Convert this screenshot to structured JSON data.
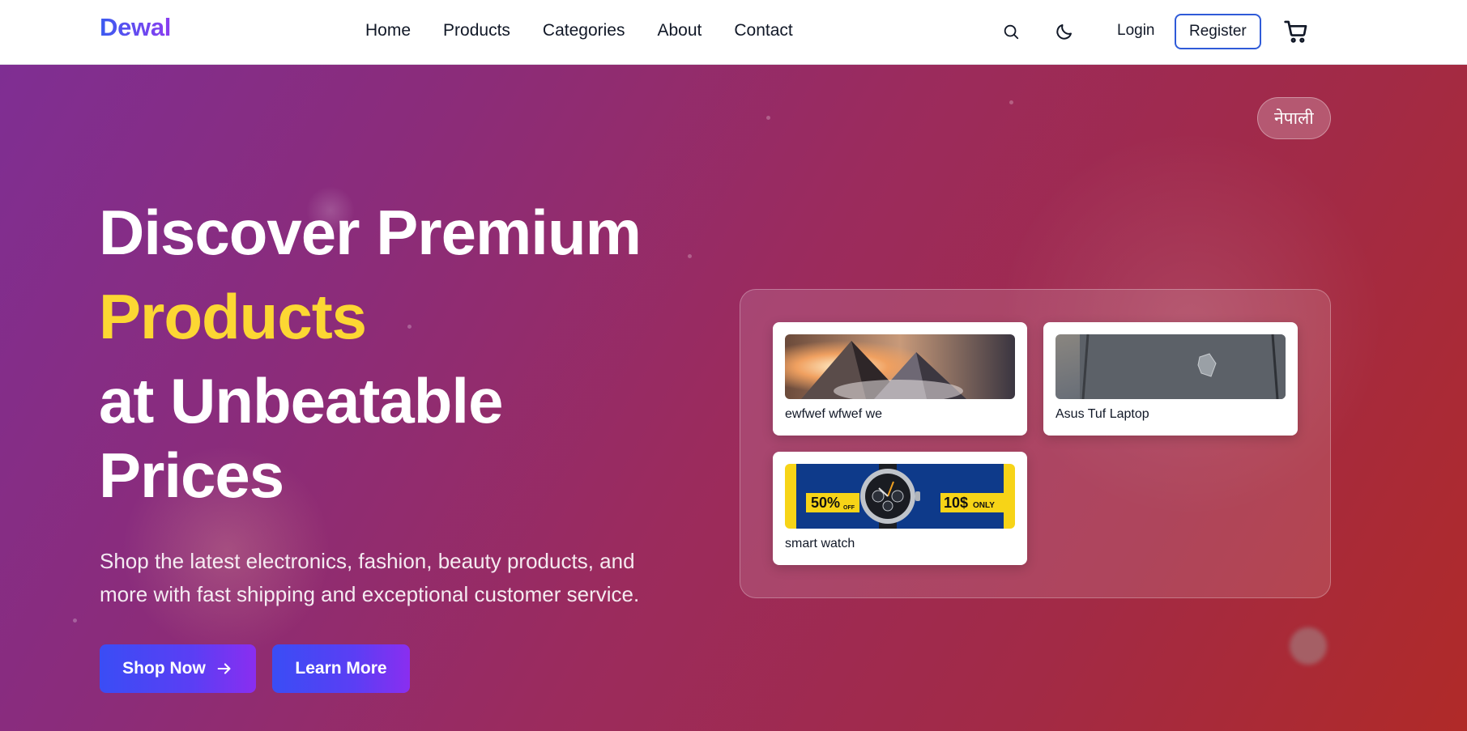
{
  "brand": {
    "name": "Dewal"
  },
  "nav": {
    "links": [
      "Home",
      "Products",
      "Categories",
      "About",
      "Contact"
    ],
    "login_label": "Login",
    "register_label": "Register"
  },
  "icons": {
    "search": "search-icon",
    "theme": "moon-icon",
    "cart": "cart-icon",
    "arrow": "arrow-right-icon"
  },
  "hero": {
    "language_toggle": "नेपाली",
    "headline": {
      "line1": "Discover Premium",
      "line2": "Products",
      "line3": "at Unbeatable",
      "line4": "Prices"
    },
    "subtitle": "Shop the latest electronics, fashion, beauty products, and more with fast shipping and exceptional customer service.",
    "shop_now_label": "Shop Now",
    "learn_more_label": "Learn More"
  },
  "featured_products": [
    {
      "name": "ewfwef wfwef we"
    },
    {
      "name": "Asus Tuf Laptop"
    },
    {
      "name": "smart watch",
      "image_text": {
        "discount": "50%",
        "discount_suffix": "OFF",
        "price": "10$",
        "price_suffix": "ONLY"
      }
    }
  ],
  "colors": {
    "accent_blue": "#2f5bd8",
    "highlight_yellow": "#fcd733",
    "gradient_start": "#7f2e93",
    "gradient_end": "#b02a28"
  }
}
